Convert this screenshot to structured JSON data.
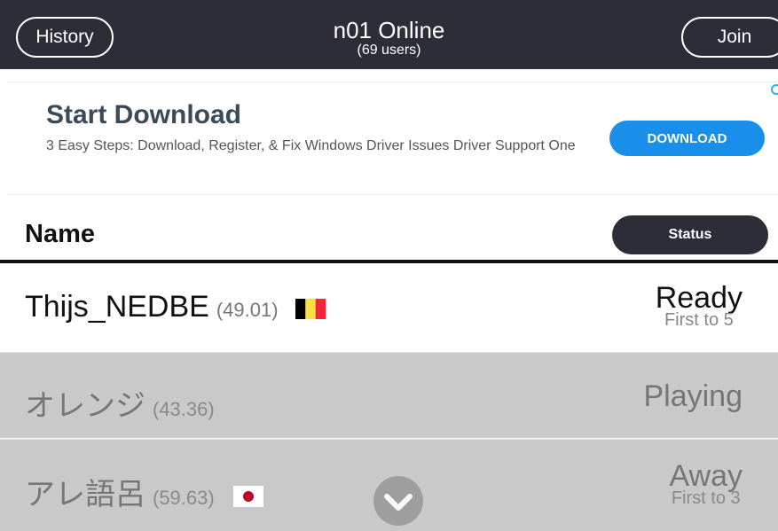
{
  "header": {
    "history_label": "History",
    "title": "n01 Online",
    "subtitle": "(69 users)",
    "join_label": "Join"
  },
  "ad": {
    "title": "Start Download",
    "description": "3 Easy Steps: Download, Register, & Fix Windows Driver Issues Driver Support One",
    "button_label": "DOWNLOAD",
    "info_icon": "info-icon"
  },
  "table": {
    "name_header": "Name",
    "status_header": "Status",
    "rows": [
      {
        "name": "Thijs_NEDBE",
        "average": "(49.01)",
        "flag": "belgium-flag",
        "status": "Ready",
        "detail": "First to 5"
      },
      {
        "name": "オレンジ",
        "average": "(43.36)",
        "flag": "",
        "status": "Playing",
        "detail": ""
      },
      {
        "name": "アレ語呂",
        "average": "(59.63)",
        "flag": "japan-flag",
        "status": "Away",
        "detail": "First to 3"
      }
    ]
  },
  "colors": {
    "topbar": "#2d2d37",
    "ad_button": "#1a8fea",
    "row_inactive": "#c9c9c9"
  },
  "icons": {
    "scroll_down": "chevron-down-icon"
  }
}
